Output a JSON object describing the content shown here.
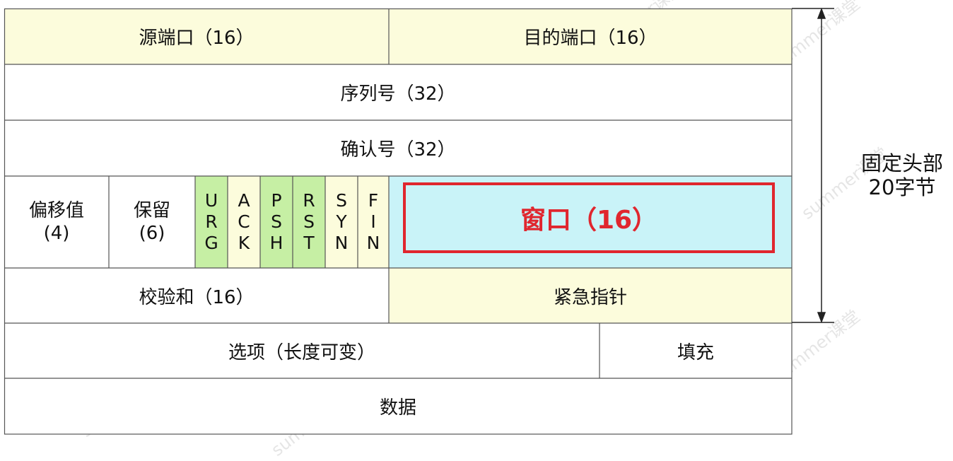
{
  "header": {
    "src_port": "源端口（16）",
    "dst_port": "目的端口（16）",
    "seq": "序列号（32）",
    "ack_num": "确认号（32）",
    "offset_line1": "偏移值",
    "offset_line2": "(4)",
    "reserved_line1": "保留",
    "reserved_line2": "(6)",
    "flags": [
      {
        "chars": [
          "U",
          "R",
          "G"
        ]
      },
      {
        "chars": [
          "A",
          "C",
          "K"
        ]
      },
      {
        "chars": [
          "P",
          "S",
          "H"
        ]
      },
      {
        "chars": [
          "R",
          "S",
          "T"
        ]
      },
      {
        "chars": [
          "S",
          "Y",
          "N"
        ]
      },
      {
        "chars": [
          "F",
          "I",
          "N"
        ]
      }
    ],
    "window": "窗口（16）",
    "checksum": "校验和（16）",
    "urgent": "紧急指针",
    "options": "选项（长度可变）",
    "padding": "填充",
    "data": "数据"
  },
  "annotation": {
    "line1": "固定头部",
    "line2": "20字节"
  },
  "watermark": "summer课堂",
  "colors": {
    "yellow": "#fcfcdc",
    "green": "#c6efa4",
    "cyan": "#c9f3f8",
    "red": "#e0262e"
  }
}
